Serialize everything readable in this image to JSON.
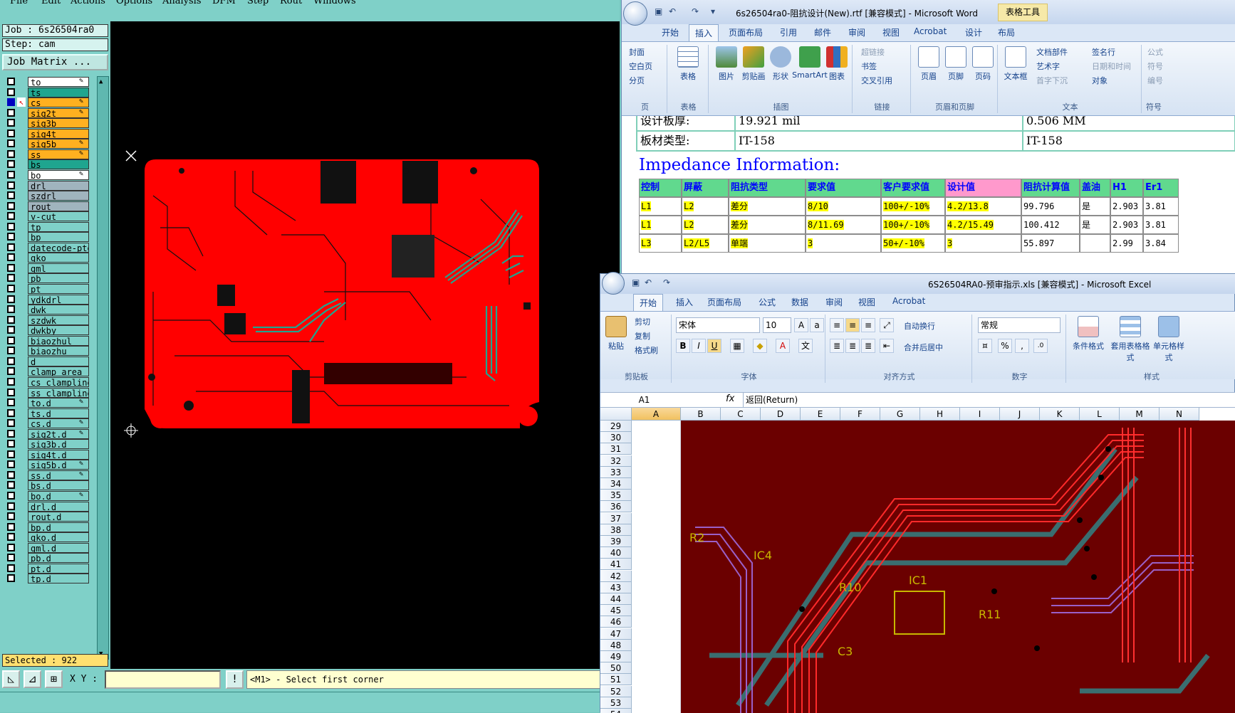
{
  "cam": {
    "menu": [
      "File",
      "Edit",
      "Actions",
      "Options",
      "Analysis",
      "DFM",
      "Step",
      "Rout",
      "Windows"
    ],
    "job": "Job : 6s26504ra0",
    "step": "Step: cam",
    "job_matrix": "Job Matrix ...",
    "layers": [
      {
        "name": "to",
        "color": "#ffffff",
        "edit": true
      },
      {
        "name": "ts",
        "color": "#1fa58f",
        "edit": false
      },
      {
        "name": "cs",
        "color": "#ffb020",
        "edit": true,
        "active": true
      },
      {
        "name": "sig2t",
        "color": "#ffb020",
        "edit": true
      },
      {
        "name": "sig3b",
        "color": "#ffb020",
        "edit": false
      },
      {
        "name": "sig4t",
        "color": "#ffb020",
        "edit": false
      },
      {
        "name": "sig5b",
        "color": "#ffb020",
        "edit": true
      },
      {
        "name": "ss",
        "color": "#ffb020",
        "edit": true
      },
      {
        "name": "bs",
        "color": "#1fa58f",
        "edit": false
      },
      {
        "name": "bo",
        "color": "#ffffff",
        "edit": true
      },
      {
        "name": "drl",
        "color": "#a0b4be",
        "edit": false
      },
      {
        "name": "szdrl",
        "color": "#a0b4be",
        "edit": false
      },
      {
        "name": "rout",
        "color": "#a0b4be",
        "edit": false
      },
      {
        "name": "v-cut",
        "color": "#7fd0c8",
        "edit": false
      },
      {
        "name": "tp",
        "color": "#7fd0c8",
        "edit": false
      },
      {
        "name": "bp",
        "color": "#7fd0c8",
        "edit": false
      },
      {
        "name": "datecode-pte",
        "color": "#7fd0c8",
        "edit": false
      },
      {
        "name": "gko",
        "color": "#7fd0c8",
        "edit": false
      },
      {
        "name": "gml",
        "color": "#7fd0c8",
        "edit": false
      },
      {
        "name": "pb",
        "color": "#7fd0c8",
        "edit": false
      },
      {
        "name": "pt",
        "color": "#7fd0c8",
        "edit": false
      },
      {
        "name": "ydkdrl",
        "color": "#7fd0c8",
        "edit": false
      },
      {
        "name": "dwk",
        "color": "#7fd0c8",
        "edit": false
      },
      {
        "name": "szdwk",
        "color": "#7fd0c8",
        "edit": false
      },
      {
        "name": "dwkby",
        "color": "#7fd0c8",
        "edit": false
      },
      {
        "name": "biaozhul",
        "color": "#7fd0c8",
        "edit": false
      },
      {
        "name": "biaozhu",
        "color": "#7fd0c8",
        "edit": false
      },
      {
        "name": "d",
        "color": "#7fd0c8",
        "edit": false
      },
      {
        "name": "clamp_area",
        "color": "#7fd0c8",
        "edit": false
      },
      {
        "name": "cs_clampline",
        "color": "#7fd0c8",
        "edit": false
      },
      {
        "name": "ss_clampline",
        "color": "#7fd0c8",
        "edit": false
      },
      {
        "name": "to.d",
        "color": "#7fd0c8",
        "edit": true
      },
      {
        "name": "ts.d",
        "color": "#7fd0c8",
        "edit": false
      },
      {
        "name": "cs.d",
        "color": "#7fd0c8",
        "edit": true
      },
      {
        "name": "sig2t.d",
        "color": "#7fd0c8",
        "edit": true
      },
      {
        "name": "sig3b.d",
        "color": "#7fd0c8",
        "edit": false
      },
      {
        "name": "sig4t.d",
        "color": "#7fd0c8",
        "edit": false
      },
      {
        "name": "sig5b.d",
        "color": "#7fd0c8",
        "edit": true
      },
      {
        "name": "ss.d",
        "color": "#7fd0c8",
        "edit": true
      },
      {
        "name": "bs.d",
        "color": "#7fd0c8",
        "edit": false
      },
      {
        "name": "bo.d",
        "color": "#7fd0c8",
        "edit": true
      },
      {
        "name": "drl.d",
        "color": "#7fd0c8",
        "edit": false
      },
      {
        "name": "rout.d",
        "color": "#7fd0c8",
        "edit": false
      },
      {
        "name": "bp.d",
        "color": "#7fd0c8",
        "edit": false
      },
      {
        "name": "gko.d",
        "color": "#7fd0c8",
        "edit": false
      },
      {
        "name": "gml.d",
        "color": "#7fd0c8",
        "edit": false
      },
      {
        "name": "pb.d",
        "color": "#7fd0c8",
        "edit": false
      },
      {
        "name": "pt.d",
        "color": "#7fd0c8",
        "edit": false
      },
      {
        "name": "tp.d",
        "color": "#7fd0c8",
        "edit": false
      }
    ],
    "selected": "Selected : 922",
    "xy_label": "X Y :",
    "xy_value": "",
    "prompt": "<M1> - Select first corner"
  },
  "word": {
    "title": "6s26504ra0-阻抗设计(New).rtf [兼容模式] - Microsoft Word",
    "context_tab": "表格工具",
    "tabs": [
      "开始",
      "插入",
      "页面布局",
      "引用",
      "邮件",
      "审阅",
      "视图",
      "Acrobat",
      "设计",
      "布局"
    ],
    "active_tab": "插入",
    "groups": {
      "pages": {
        "label": "页",
        "items": [
          "封面",
          "空白页",
          "分页"
        ]
      },
      "tables": {
        "label": "表格",
        "items": [
          "表格"
        ]
      },
      "illustrations": {
        "label": "插图",
        "items": [
          "图片",
          "剪贴画",
          "形状",
          "SmartArt",
          "图表"
        ]
      },
      "links": {
        "label": "链接",
        "items": [
          "超链接",
          "书签",
          "交叉引用"
        ]
      },
      "header_footer": {
        "label": "页眉和页脚",
        "items": [
          "页眉",
          "页脚",
          "页码"
        ]
      },
      "text": {
        "label": "文本",
        "items": [
          "文本框",
          "文档部件",
          "艺术字",
          "首字下沉",
          "签名行",
          "日期和时间",
          "对象"
        ]
      },
      "symbols": {
        "label": "符号",
        "items": [
          "公式",
          "符号",
          "编号"
        ]
      }
    },
    "doc": {
      "row1": [
        "设计板厚:",
        "19.921 mil",
        "0.506 MM"
      ],
      "row2": [
        "板材类型:",
        "IT-158",
        "IT-158"
      ],
      "impedance_title": "Impedance Information:",
      "headers": [
        "控制",
        "屏蔽",
        "阻抗类型",
        "要求值",
        "客户要求值",
        "设计值",
        "阻抗计算值",
        "盖油",
        "H1",
        "Er1"
      ],
      "rows": [
        [
          "L1",
          "L2",
          "差分",
          "8/10",
          "100+/-10%",
          "4.2/13.8",
          "99.796",
          "是",
          "2.903",
          "3.81"
        ],
        [
          "L1",
          "L2",
          "差分",
          "8/11.69",
          "100+/-10%",
          "4.2/15.49",
          "100.412",
          "是",
          "2.903",
          "3.81"
        ],
        [
          "L3",
          "L2/L5",
          "单端",
          "3",
          "50+/-10%",
          "3",
          "55.897",
          "",
          "2.99",
          "3.84"
        ]
      ]
    }
  },
  "excel": {
    "title": "6S26504RA0-预审指示.xls [兼容模式] - Microsoft Excel",
    "tabs": [
      "开始",
      "插入",
      "页面布局",
      "公式",
      "数据",
      "审阅",
      "视图",
      "Acrobat"
    ],
    "active_tab": "开始",
    "clipboard": {
      "label": "剪贴板",
      "paste": "粘贴",
      "cut": "剪切",
      "copy": "复制",
      "format_painter": "格式刷"
    },
    "font": {
      "label": "字体",
      "name": "宋体",
      "size": "10"
    },
    "alignment": {
      "label": "对齐方式",
      "wrap": "自动换行",
      "merge": "合并后居中"
    },
    "number": {
      "label": "数字",
      "format": "常规"
    },
    "styles": {
      "label": "样式",
      "conditional": "条件格式",
      "table": "套用表格格式",
      "cell": "单元格样式"
    },
    "name_box": "A1",
    "fx": "fx",
    "formula": "返回(Return)",
    "columns": [
      "A",
      "B",
      "C",
      "D",
      "E",
      "F",
      "G",
      "H",
      "I",
      "J",
      "K",
      "L",
      "M",
      "N"
    ],
    "rows": [
      "29",
      "30",
      "31",
      "32",
      "33",
      "34",
      "35",
      "36",
      "37",
      "38",
      "39",
      "40",
      "41",
      "42",
      "43",
      "44",
      "45",
      "46",
      "47",
      "48",
      "49",
      "50",
      "51",
      "52",
      "53",
      "54"
    ],
    "pcb_labels": [
      "IC4",
      "IC1",
      "R10",
      "R11",
      "C3",
      "R2"
    ]
  }
}
